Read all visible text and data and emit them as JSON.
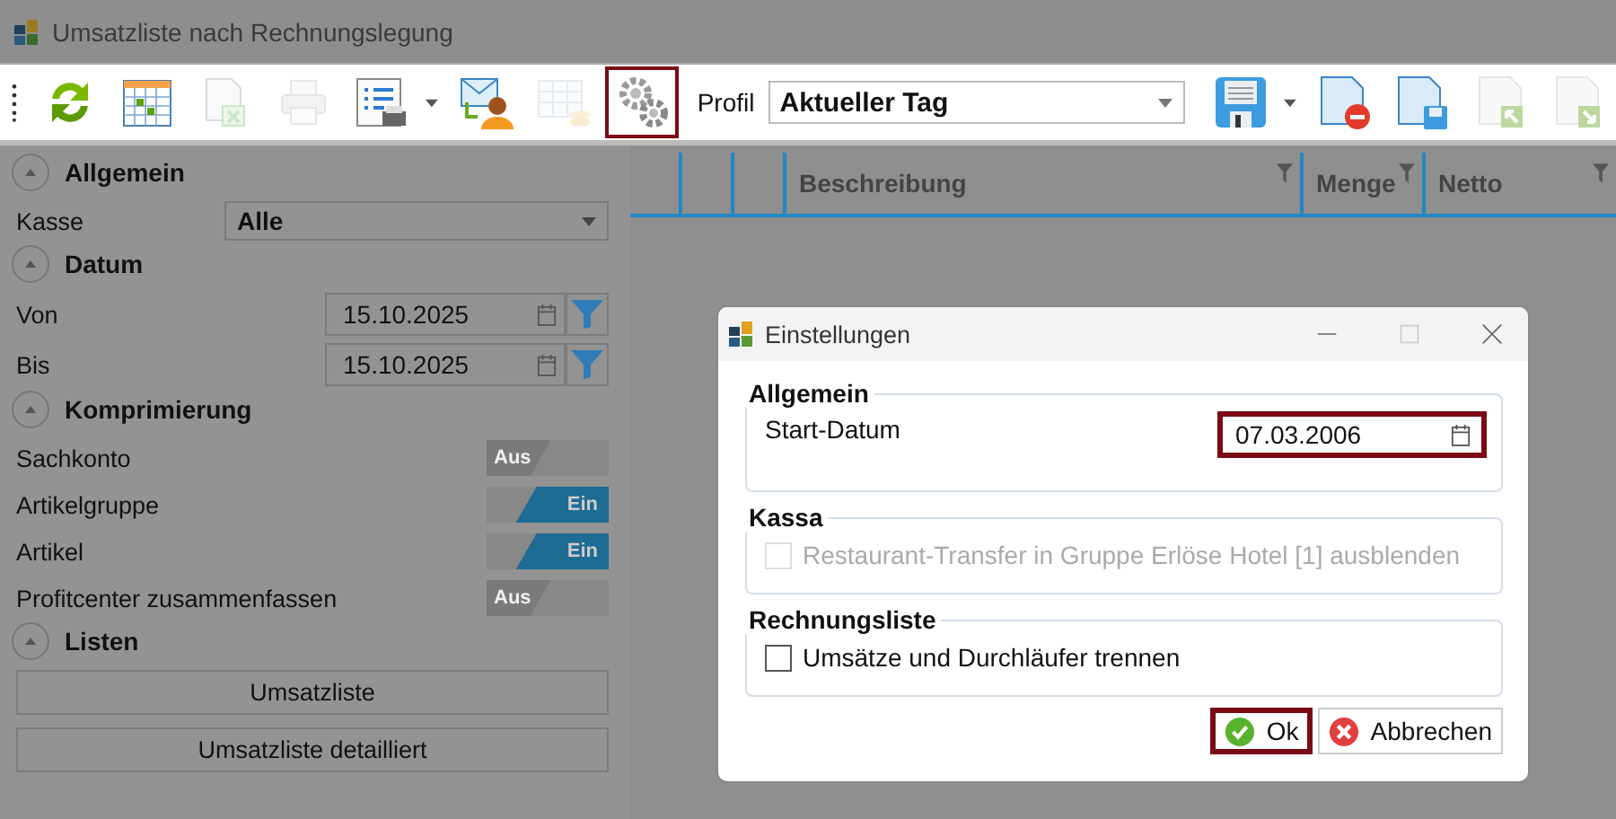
{
  "window": {
    "title": "Umsatzliste nach Rechnungslegung"
  },
  "toolbar": {
    "items": [
      {
        "kind": "refresh",
        "disabled": false,
        "highlighted": false,
        "caret": false
      },
      {
        "kind": "calendar",
        "disabled": false,
        "highlighted": false,
        "caret": false
      },
      {
        "kind": "export",
        "disabled": true,
        "highlighted": false,
        "caret": false
      },
      {
        "kind": "print",
        "disabled": true,
        "highlighted": false,
        "caret": false
      },
      {
        "kind": "list-print",
        "disabled": false,
        "highlighted": false,
        "caret": true
      },
      {
        "kind": "mail-user",
        "disabled": false,
        "highlighted": false,
        "caret": false
      },
      {
        "kind": "table-coins",
        "disabled": true,
        "highlighted": false,
        "caret": false
      },
      {
        "kind": "gears",
        "disabled": false,
        "highlighted": true,
        "caret": false
      }
    ],
    "profile_label": "Profil",
    "profile_value": "Aktueller Tag",
    "file_items": [
      {
        "kind": "save",
        "disabled": false,
        "caret": true
      },
      {
        "kind": "doc-remove",
        "disabled": false,
        "caret": false
      },
      {
        "kind": "doc-save",
        "disabled": false,
        "caret": false
      },
      {
        "kind": "doc-import",
        "disabled": true,
        "caret": false
      },
      {
        "kind": "doc-export",
        "disabled": true,
        "caret": false
      }
    ]
  },
  "sidebar": {
    "sections": [
      {
        "title": "Allgemein",
        "expanded": true,
        "rows": [
          {
            "kind": "select",
            "label": "Kasse",
            "value": "Alle"
          }
        ]
      },
      {
        "title": "Datum",
        "expanded": true,
        "rows": [
          {
            "kind": "date",
            "label": "Von",
            "value": "15.10.2025"
          },
          {
            "kind": "date",
            "label": "Bis",
            "value": "15.10.2025"
          }
        ]
      },
      {
        "title": "Komprimierung",
        "expanded": true,
        "rows": [
          {
            "kind": "toggle",
            "label": "Sachkonto",
            "on": false,
            "text": "Aus"
          },
          {
            "kind": "toggle",
            "label": "Artikelgruppe",
            "on": true,
            "text": "Ein"
          },
          {
            "kind": "toggle",
            "label": "Artikel",
            "on": true,
            "text": "Ein"
          },
          {
            "kind": "toggle",
            "label": "Profitcenter zusammenfassen",
            "on": false,
            "text": "Aus"
          }
        ]
      },
      {
        "title": "Listen",
        "expanded": true,
        "rows": [
          {
            "kind": "button",
            "label": "Umsatzliste"
          },
          {
            "kind": "button",
            "label": "Umsatzliste detailliert"
          }
        ]
      }
    ]
  },
  "table": {
    "columns": [
      {
        "label": "Beschreibung"
      },
      {
        "label": "Menge"
      },
      {
        "label": "Netto"
      }
    ]
  },
  "dialog": {
    "title": "Einstellungen",
    "groups": [
      {
        "title": "Allgemein",
        "kind": "date",
        "label": "Start-Datum",
        "value": "07.03.2006",
        "highlighted": true
      },
      {
        "title": "Kassa",
        "kind": "checkbox",
        "label": "Restaurant-Transfer in Gruppe Erlöse Hotel [1] ausblenden",
        "checked": false,
        "disabled": true
      },
      {
        "title": "Rechnungsliste",
        "kind": "checkbox",
        "label": "Umsätze und Durchläufer trennen",
        "checked": false,
        "disabled": false
      }
    ],
    "buttons": [
      {
        "kind": "ok",
        "label": "Ok",
        "highlighted": true
      },
      {
        "kind": "cancel",
        "label": "Abbrechen",
        "highlighted": false
      }
    ]
  }
}
